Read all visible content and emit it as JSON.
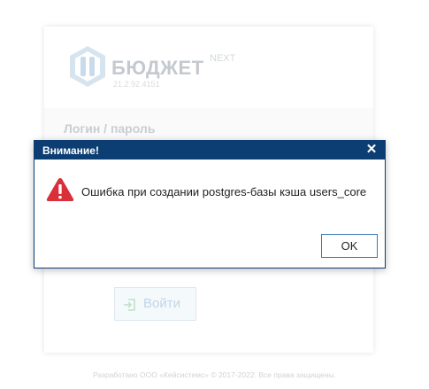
{
  "login": {
    "logo_text": "БЮДЖЕТ",
    "logo_suffix": "NEXT",
    "version": "21.2.92.4151",
    "section_title": "Логин / пароль",
    "submit_label": "Войти"
  },
  "footer": {
    "text": "Разработано ООО «Кейсистемс» © 2017-2022. Все права защищены."
  },
  "dialog": {
    "title": "Внимание!",
    "close_glyph": "✕",
    "message": "Ошибка при создании postgres-базы кэша users_core",
    "ok_label": "OK"
  },
  "colors": {
    "dialog_header": "#0c3d73",
    "warning": "#d9303a",
    "ok_border": "#3a7ab3"
  },
  "icons": {
    "logo": "hexagon-logo-icon",
    "login": "sign-in-icon",
    "warning": "warning-triangle-icon",
    "close": "close-icon"
  }
}
